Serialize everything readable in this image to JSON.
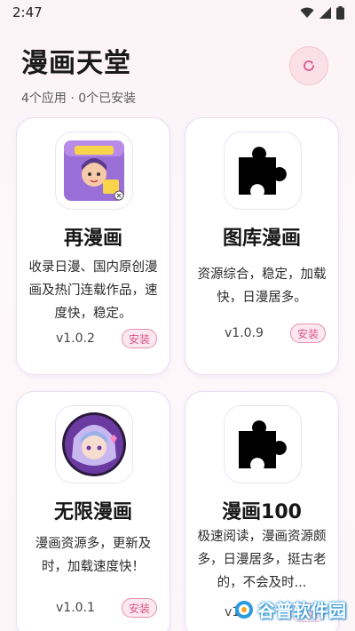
{
  "status_bar": {
    "time": "2:47"
  },
  "header": {
    "title": "漫画天堂",
    "subtitle": "4个应用 · 0个已安装"
  },
  "apps": [
    {
      "name": "再漫画",
      "description": "收录日漫、国内原创漫画及热门连载作品，速度快，稳定。",
      "version": "v1.0.2",
      "install_label": "安装",
      "icon": "zaimanhua-app-icon"
    },
    {
      "name": "图库漫画",
      "description": "资源综合，稳定，加载快，日漫居多。",
      "version": "v1.0.9",
      "install_label": "安装",
      "icon": "puzzle-icon"
    },
    {
      "name": "无限漫画",
      "description": "漫画资源多，更新及时，加载速度快！",
      "version": "v1.0.1",
      "install_label": "安装",
      "icon": "anime-girl-avatar-icon"
    },
    {
      "name": "漫画100",
      "description": "极速阅读，漫画资源颇多，日漫居多，挺古老的，不会及时...",
      "version": "v1.",
      "install_label": "安装",
      "icon": "puzzle-icon"
    }
  ],
  "watermark": {
    "text": "谷普软件园"
  },
  "colors": {
    "accent": "#d9578a",
    "card_border": "#e6dff3",
    "refresh_bg": "#fbe0e8"
  }
}
